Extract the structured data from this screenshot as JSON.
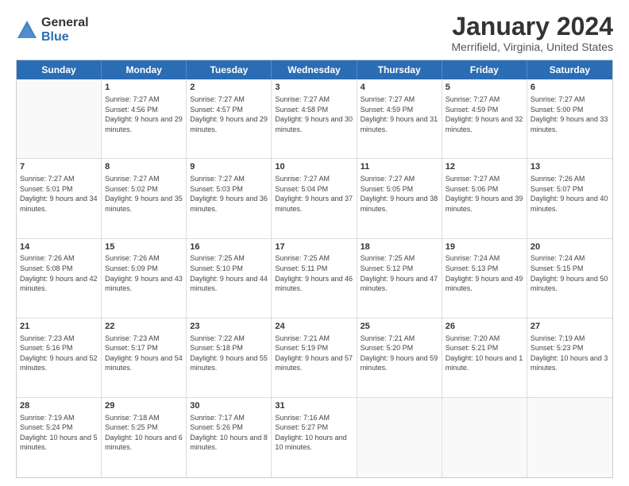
{
  "logo": {
    "general": "General",
    "blue": "Blue"
  },
  "title": "January 2024",
  "subtitle": "Merrifield, Virginia, United States",
  "header_days": [
    "Sunday",
    "Monday",
    "Tuesday",
    "Wednesday",
    "Thursday",
    "Friday",
    "Saturday"
  ],
  "weeks": [
    [
      {
        "day": "",
        "empty": true
      },
      {
        "day": "1",
        "sunrise": "Sunrise: 7:27 AM",
        "sunset": "Sunset: 4:56 PM",
        "daylight": "Daylight: 9 hours and 29 minutes."
      },
      {
        "day": "2",
        "sunrise": "Sunrise: 7:27 AM",
        "sunset": "Sunset: 4:57 PM",
        "daylight": "Daylight: 9 hours and 29 minutes."
      },
      {
        "day": "3",
        "sunrise": "Sunrise: 7:27 AM",
        "sunset": "Sunset: 4:58 PM",
        "daylight": "Daylight: 9 hours and 30 minutes."
      },
      {
        "day": "4",
        "sunrise": "Sunrise: 7:27 AM",
        "sunset": "Sunset: 4:59 PM",
        "daylight": "Daylight: 9 hours and 31 minutes."
      },
      {
        "day": "5",
        "sunrise": "Sunrise: 7:27 AM",
        "sunset": "Sunset: 4:59 PM",
        "daylight": "Daylight: 9 hours and 32 minutes."
      },
      {
        "day": "6",
        "sunrise": "Sunrise: 7:27 AM",
        "sunset": "Sunset: 5:00 PM",
        "daylight": "Daylight: 9 hours and 33 minutes."
      }
    ],
    [
      {
        "day": "7",
        "sunrise": "Sunrise: 7:27 AM",
        "sunset": "Sunset: 5:01 PM",
        "daylight": "Daylight: 9 hours and 34 minutes."
      },
      {
        "day": "8",
        "sunrise": "Sunrise: 7:27 AM",
        "sunset": "Sunset: 5:02 PM",
        "daylight": "Daylight: 9 hours and 35 minutes."
      },
      {
        "day": "9",
        "sunrise": "Sunrise: 7:27 AM",
        "sunset": "Sunset: 5:03 PM",
        "daylight": "Daylight: 9 hours and 36 minutes."
      },
      {
        "day": "10",
        "sunrise": "Sunrise: 7:27 AM",
        "sunset": "Sunset: 5:04 PM",
        "daylight": "Daylight: 9 hours and 37 minutes."
      },
      {
        "day": "11",
        "sunrise": "Sunrise: 7:27 AM",
        "sunset": "Sunset: 5:05 PM",
        "daylight": "Daylight: 9 hours and 38 minutes."
      },
      {
        "day": "12",
        "sunrise": "Sunrise: 7:27 AM",
        "sunset": "Sunset: 5:06 PM",
        "daylight": "Daylight: 9 hours and 39 minutes."
      },
      {
        "day": "13",
        "sunrise": "Sunrise: 7:26 AM",
        "sunset": "Sunset: 5:07 PM",
        "daylight": "Daylight: 9 hours and 40 minutes."
      }
    ],
    [
      {
        "day": "14",
        "sunrise": "Sunrise: 7:26 AM",
        "sunset": "Sunset: 5:08 PM",
        "daylight": "Daylight: 9 hours and 42 minutes."
      },
      {
        "day": "15",
        "sunrise": "Sunrise: 7:26 AM",
        "sunset": "Sunset: 5:09 PM",
        "daylight": "Daylight: 9 hours and 43 minutes."
      },
      {
        "day": "16",
        "sunrise": "Sunrise: 7:25 AM",
        "sunset": "Sunset: 5:10 PM",
        "daylight": "Daylight: 9 hours and 44 minutes."
      },
      {
        "day": "17",
        "sunrise": "Sunrise: 7:25 AM",
        "sunset": "Sunset: 5:11 PM",
        "daylight": "Daylight: 9 hours and 46 minutes."
      },
      {
        "day": "18",
        "sunrise": "Sunrise: 7:25 AM",
        "sunset": "Sunset: 5:12 PM",
        "daylight": "Daylight: 9 hours and 47 minutes."
      },
      {
        "day": "19",
        "sunrise": "Sunrise: 7:24 AM",
        "sunset": "Sunset: 5:13 PM",
        "daylight": "Daylight: 9 hours and 49 minutes."
      },
      {
        "day": "20",
        "sunrise": "Sunrise: 7:24 AM",
        "sunset": "Sunset: 5:15 PM",
        "daylight": "Daylight: 9 hours and 50 minutes."
      }
    ],
    [
      {
        "day": "21",
        "sunrise": "Sunrise: 7:23 AM",
        "sunset": "Sunset: 5:16 PM",
        "daylight": "Daylight: 9 hours and 52 minutes."
      },
      {
        "day": "22",
        "sunrise": "Sunrise: 7:23 AM",
        "sunset": "Sunset: 5:17 PM",
        "daylight": "Daylight: 9 hours and 54 minutes."
      },
      {
        "day": "23",
        "sunrise": "Sunrise: 7:22 AM",
        "sunset": "Sunset: 5:18 PM",
        "daylight": "Daylight: 9 hours and 55 minutes."
      },
      {
        "day": "24",
        "sunrise": "Sunrise: 7:21 AM",
        "sunset": "Sunset: 5:19 PM",
        "daylight": "Daylight: 9 hours and 57 minutes."
      },
      {
        "day": "25",
        "sunrise": "Sunrise: 7:21 AM",
        "sunset": "Sunset: 5:20 PM",
        "daylight": "Daylight: 9 hours and 59 minutes."
      },
      {
        "day": "26",
        "sunrise": "Sunrise: 7:20 AM",
        "sunset": "Sunset: 5:21 PM",
        "daylight": "Daylight: 10 hours and 1 minute."
      },
      {
        "day": "27",
        "sunrise": "Sunrise: 7:19 AM",
        "sunset": "Sunset: 5:23 PM",
        "daylight": "Daylight: 10 hours and 3 minutes."
      }
    ],
    [
      {
        "day": "28",
        "sunrise": "Sunrise: 7:19 AM",
        "sunset": "Sunset: 5:24 PM",
        "daylight": "Daylight: 10 hours and 5 minutes."
      },
      {
        "day": "29",
        "sunrise": "Sunrise: 7:18 AM",
        "sunset": "Sunset: 5:25 PM",
        "daylight": "Daylight: 10 hours and 6 minutes."
      },
      {
        "day": "30",
        "sunrise": "Sunrise: 7:17 AM",
        "sunset": "Sunset: 5:26 PM",
        "daylight": "Daylight: 10 hours and 8 minutes."
      },
      {
        "day": "31",
        "sunrise": "Sunrise: 7:16 AM",
        "sunset": "Sunset: 5:27 PM",
        "daylight": "Daylight: 10 hours and 10 minutes."
      },
      {
        "day": "",
        "empty": true
      },
      {
        "day": "",
        "empty": true
      },
      {
        "day": "",
        "empty": true
      }
    ]
  ]
}
